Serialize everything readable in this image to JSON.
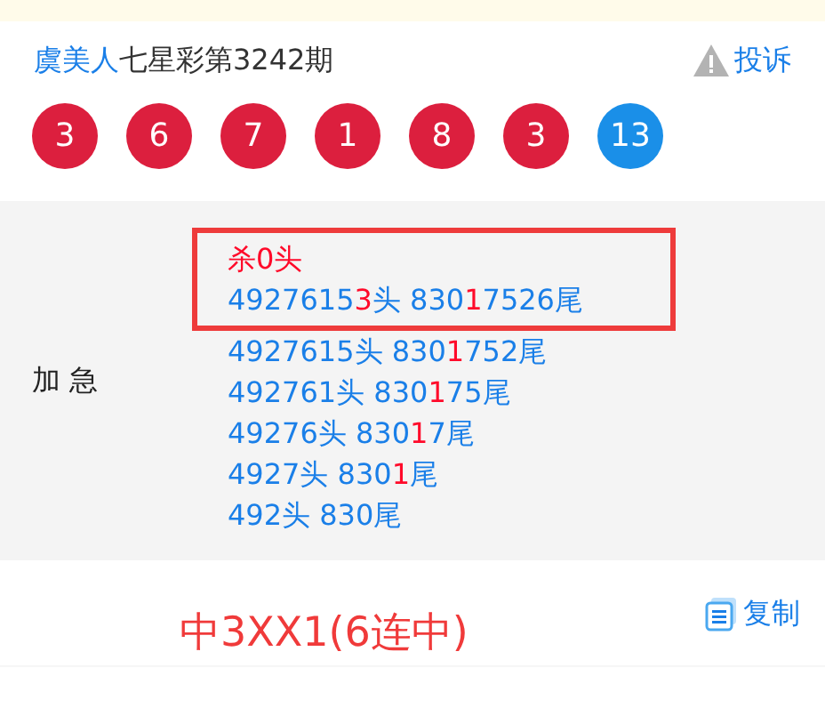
{
  "header": {
    "author": "虞美人",
    "title": "七星彩第3242期",
    "report": "投诉"
  },
  "balls": [
    {
      "number": "3",
      "kind": "red"
    },
    {
      "number": "6",
      "kind": "red"
    },
    {
      "number": "7",
      "kind": "red"
    },
    {
      "number": "1",
      "kind": "red"
    },
    {
      "number": "8",
      "kind": "red"
    },
    {
      "number": "3",
      "kind": "red"
    },
    {
      "number": "13",
      "kind": "blue"
    }
  ],
  "prediction": {
    "label": "加 急",
    "lines": [
      {
        "boxed": true,
        "segments": [
          {
            "text": "杀0头",
            "highlight": true
          }
        ]
      },
      {
        "boxed": true,
        "segments": [
          {
            "text": "4927615",
            "highlight": false
          },
          {
            "text": "3",
            "highlight": true
          },
          {
            "text": "头 830",
            "highlight": false
          },
          {
            "text": "1",
            "highlight": true
          },
          {
            "text": "7526尾",
            "highlight": false
          }
        ]
      },
      {
        "boxed": false,
        "segments": [
          {
            "text": "4927615头 830",
            "highlight": false
          },
          {
            "text": "1",
            "highlight": true
          },
          {
            "text": "752尾",
            "highlight": false
          }
        ]
      },
      {
        "boxed": false,
        "segments": [
          {
            "text": "492761头 830",
            "highlight": false
          },
          {
            "text": "1",
            "highlight": true
          },
          {
            "text": "75尾",
            "highlight": false
          }
        ]
      },
      {
        "boxed": false,
        "segments": [
          {
            "text": "49276头 830",
            "highlight": false
          },
          {
            "text": "1",
            "highlight": true
          },
          {
            "text": "7尾",
            "highlight": false
          }
        ]
      },
      {
        "boxed": false,
        "segments": [
          {
            "text": "4927头 830",
            "highlight": false
          },
          {
            "text": "1",
            "highlight": true
          },
          {
            "text": "尾",
            "highlight": false
          }
        ]
      },
      {
        "boxed": false,
        "segments": [
          {
            "text": "492头 830尾",
            "highlight": false
          }
        ]
      }
    ]
  },
  "result": {
    "text": "中3XX1(6连中)",
    "copy": "复制"
  }
}
